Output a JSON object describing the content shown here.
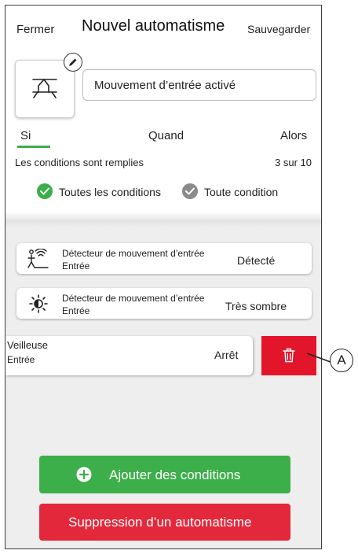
{
  "header": {
    "close_label": "Fermer",
    "title": "Nouvel automatisme",
    "save_label": "Sauvegarder"
  },
  "automation": {
    "name": "Mouvement d’entrée activé",
    "icon": "motion-sensor-ceiling-icon"
  },
  "tabs": [
    {
      "label": "Si",
      "active": true
    },
    {
      "label": "Quand"
    },
    {
      "label": "Alors"
    }
  ],
  "conditions": {
    "summary": "Les conditions sont remplies",
    "count": "3 sur 10",
    "options": [
      {
        "label": "Toutes les conditions",
        "selected": true,
        "color": "#3cae4a"
      },
      {
        "label": "Toute condition",
        "selected": false,
        "color": "#8a8a8a"
      }
    ],
    "items": [
      {
        "device": "Détecteur de mouvement d’entrée",
        "room": "Entrée",
        "value": "Détecté",
        "icon": "motion-person-icon"
      },
      {
        "device": "Détecteur de mouvement d’entrée",
        "room": "Entrée",
        "value": "Très sombre",
        "icon": "brightness-icon"
      },
      {
        "device": "Veilleuse",
        "room": "Entrée",
        "value": "Arrêt",
        "icon": "trash-icon"
      }
    ]
  },
  "actions": {
    "add_label": "Ajouter des conditions",
    "delete_label": "Suppression d’un automatisme"
  },
  "callout": {
    "label": "A"
  },
  "colors": {
    "accent_green": "#3cae4a",
    "danger_red": "#e3152b"
  }
}
